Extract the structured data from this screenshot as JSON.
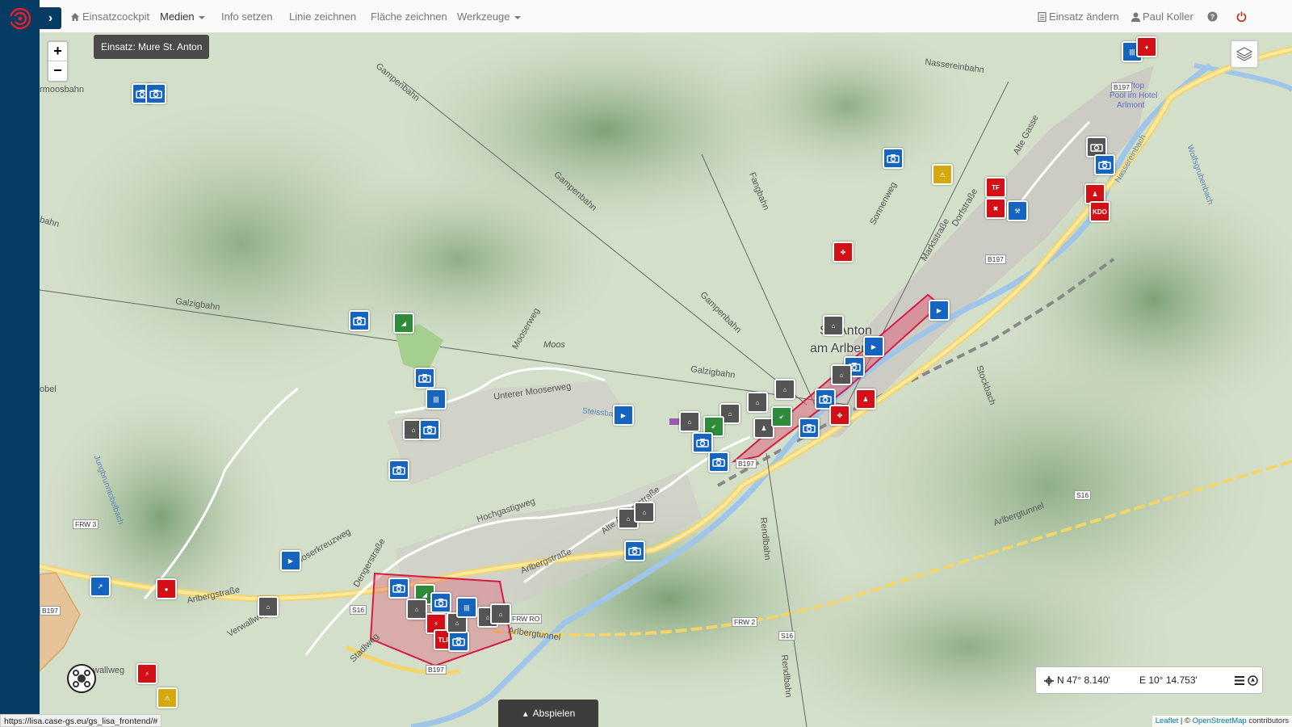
{
  "navbar": {
    "cockpit_label": "Einsatzcockpit",
    "medien_label": "Medien",
    "info_label": "Info setzen",
    "linie_label": "Linie zeichnen",
    "flaeche_label": "Fläche zeichnen",
    "werkzeuge_label": "Werkzeuge",
    "einsatz_aendern_label": "Einsatz ändern",
    "user_label": "Paul Koller"
  },
  "map": {
    "einsatz_label": "Einsatz: Mure St. Anton",
    "zoom_in": "+",
    "zoom_out": "−",
    "town_line1": "St. Anton",
    "town_line2": "am Arlberg",
    "labels": {
      "gampenbahn1": "Gampenbahn",
      "gampenbahn2": "Gampenbahn",
      "gampenbahn3": "Gampenbahn",
      "galzigbahn1": "Galzigbahn",
      "galzigbahn2": "Galzigbahn",
      "nassereinbahn": "Nassereinbahn",
      "fangbahn": "Fangbahn",
      "moos": "Moos",
      "mooserweg": "Mooserweg",
      "unterer_mooserweg": "Unterer Mooserweg",
      "arlbergstrasse1": "Arlbergstraße",
      "arlbergstrasse2": "Arlbergstraße",
      "alte_arlbergstrasse": "Alte Arlbergstraße",
      "hochgastigweg": "Hochgastigweg",
      "dengerstrasse": "Dengerstraße",
      "arlbergtunnel1": "Arlbergtunnel",
      "arlbergtunnel2": "Arlbergtunnel",
      "rendlbahn1": "Rendlbahn",
      "rendlbahn2": "Rendlbahn",
      "stockbach": "Stockbach",
      "dorfstrasse": "Dorfstraße",
      "alte_gasse": "Alte Gasse",
      "sonnenweg": "Sonnenweg",
      "marktstrasse": "Marktstraße",
      "rooftop": "Rooftop",
      "pool": "Pool im Hotel",
      "arlmont": "Arlmont",
      "steissbach": "Steissbach",
      "jungbrunntobelbach": "Jungbrunntobelbach",
      "wolfsgrubenbach": "Wolfsgrubenbach",
      "verwallweg": "Verwallweg",
      "wallweg": "wallweg",
      "stadlweg": "Stadlweg",
      "moserkreuzweg": "Moserkreuzweg",
      "obel": "obel",
      "bahn_left": "bahn",
      "moosbahn": "rmoosbahn",
      "nasserein_bach": "Nassereinbach"
    },
    "shields": {
      "b197_1": "B197",
      "b197_2": "B197",
      "b197_3": "B197",
      "b197_4": "B197",
      "b197_5": "B197",
      "s16_1": "S16",
      "s16_2": "S16",
      "s16_3": "S16",
      "frw3": "FRW 3",
      "frw2": "FRW 2",
      "frwro": "FRW RO"
    }
  },
  "coords": {
    "lat": "N 47° 8.140'",
    "lon": "E 10° 14.753'"
  },
  "play_label": "Abspielen",
  "status_url": "https://lisa.case-gs.eu/gs_lisa_frontend/#",
  "attribution": {
    "leaflet": "Leaflet",
    "sep": " | © ",
    "osm": "OpenStreetMap",
    "contributors": " contributors"
  },
  "colors": {
    "rail": "#063b63",
    "marker_blue": "#1565c0",
    "marker_red": "#d50f16",
    "marker_grey": "#555555",
    "marker_green": "#2e8b3a",
    "marker_yellow": "#d4a80f",
    "polygon": "#e0506e"
  }
}
